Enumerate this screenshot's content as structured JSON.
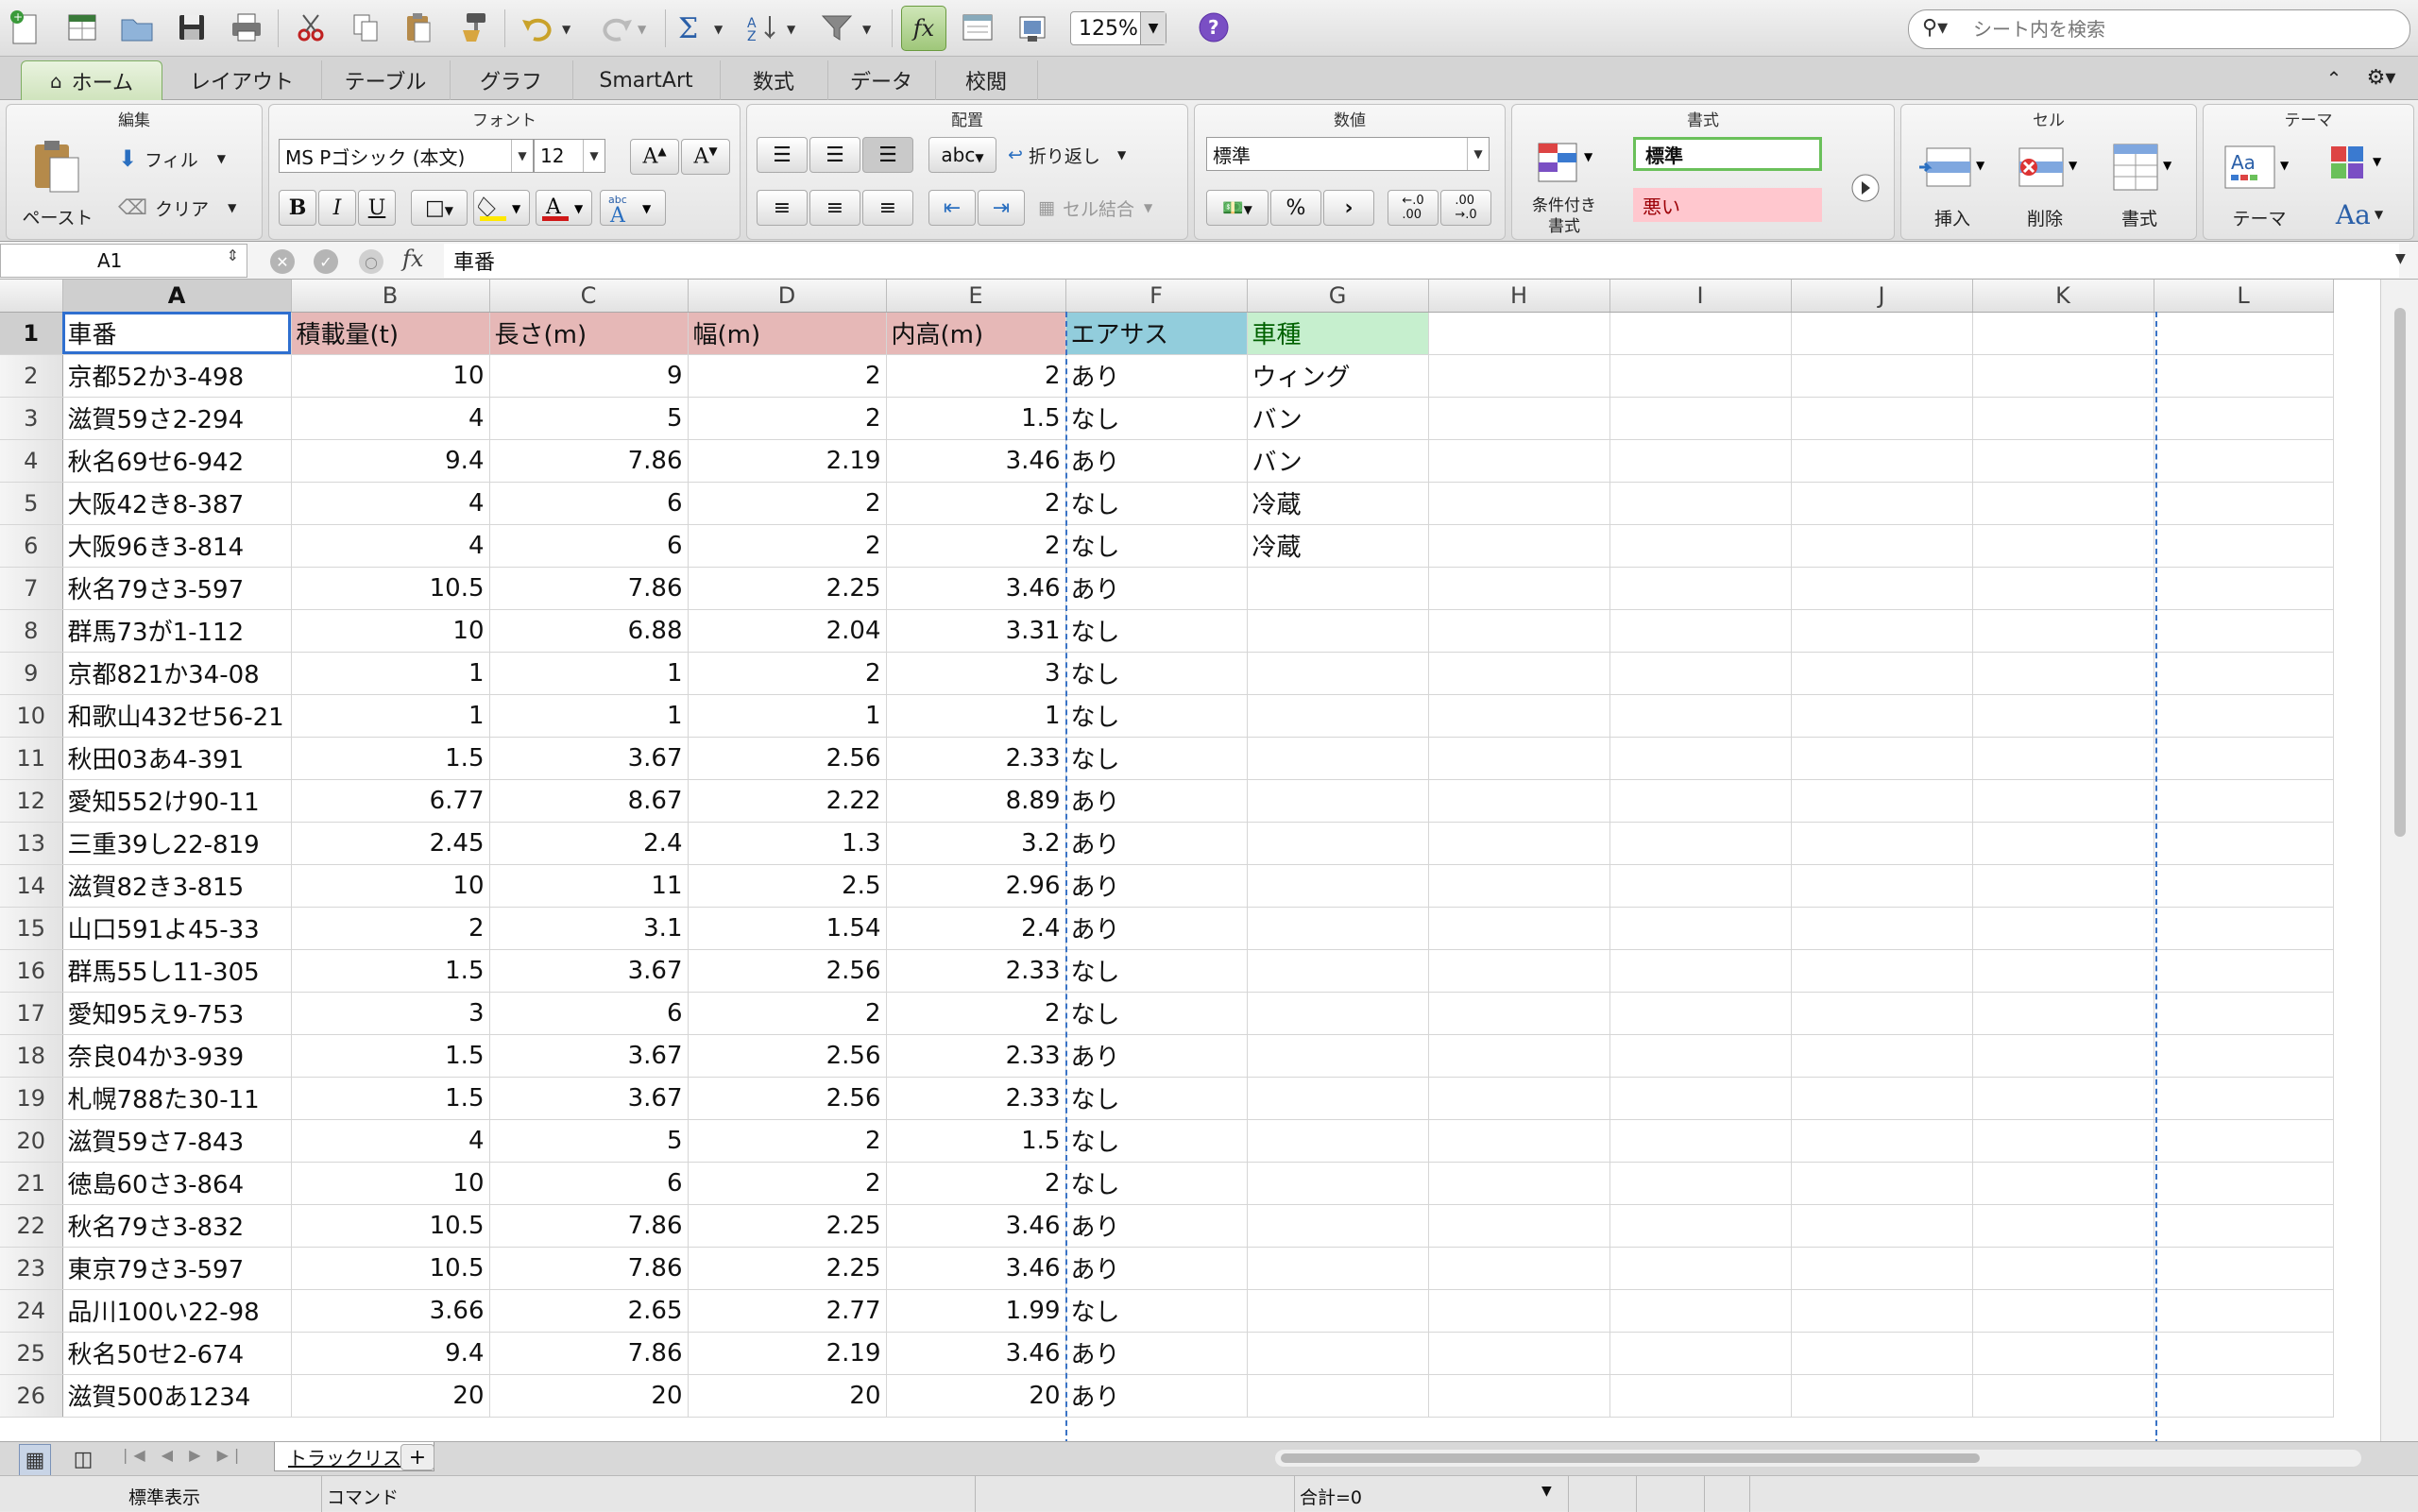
{
  "toolbar": {
    "zoom": "125%",
    "search_placeholder": "シート内を検索"
  },
  "tabs": [
    "ホーム",
    "レイアウト",
    "テーブル",
    "グラフ",
    "SmartArt",
    "数式",
    "データ",
    "校閲"
  ],
  "ribbon": {
    "edit": {
      "title": "編集",
      "paste": "ペースト",
      "fill": "フィル",
      "clear": "クリア"
    },
    "font": {
      "title": "フォント",
      "font_name": "MS Pゴシック (本文)",
      "font_size": "12"
    },
    "align": {
      "title": "配置",
      "wrap": "折り返し",
      "merge": "セル結合"
    },
    "number": {
      "title": "数値",
      "format": "標準"
    },
    "styles": {
      "title": "書式",
      "conditional": "条件付き\n書式",
      "normal": "標準",
      "bad": "悪い"
    },
    "cells": {
      "title": "セル",
      "insert": "挿入",
      "delete": "削除",
      "format": "書式"
    },
    "theme": {
      "title": "テーマ",
      "theme": "テーマ"
    }
  },
  "formula_bar": {
    "name_box": "A1",
    "fx": "fx",
    "value": "車番"
  },
  "columns": [
    "A",
    "B",
    "C",
    "D",
    "E",
    "F",
    "G",
    "H",
    "I",
    "J",
    "K",
    "L"
  ],
  "headers": [
    "車番",
    "積載量(t)",
    "長さ(m)",
    "幅(m)",
    "内高(m)",
    "エアサス",
    "車種"
  ],
  "rows": [
    [
      "京都52か3-498",
      "10",
      "9",
      "2",
      "2",
      "あり",
      "ウィング"
    ],
    [
      "滋賀59さ2-294",
      "4",
      "5",
      "2",
      "1.5",
      "なし",
      "バン"
    ],
    [
      "秋名69せ6-942",
      "9.4",
      "7.86",
      "2.19",
      "3.46",
      "あり",
      "バン"
    ],
    [
      "大阪42き8-387",
      "4",
      "6",
      "2",
      "2",
      "なし",
      "冷蔵"
    ],
    [
      "大阪96き3-814",
      "4",
      "6",
      "2",
      "2",
      "なし",
      "冷蔵"
    ],
    [
      "秋名79さ3-597",
      "10.5",
      "7.86",
      "2.25",
      "3.46",
      "あり",
      ""
    ],
    [
      "群馬73が1-112",
      "10",
      "6.88",
      "2.04",
      "3.31",
      "なし",
      ""
    ],
    [
      "京都821か34-08",
      "1",
      "1",
      "2",
      "3",
      "なし",
      ""
    ],
    [
      "和歌山432せ56-21",
      "1",
      "1",
      "1",
      "1",
      "なし",
      ""
    ],
    [
      "秋田03あ4-391",
      "1.5",
      "3.67",
      "2.56",
      "2.33",
      "なし",
      ""
    ],
    [
      "愛知552け90-11",
      "6.77",
      "8.67",
      "2.22",
      "8.89",
      "あり",
      ""
    ],
    [
      "三重39し22-819",
      "2.45",
      "2.4",
      "1.3",
      "3.2",
      "あり",
      ""
    ],
    [
      "滋賀82き3-815",
      "10",
      "11",
      "2.5",
      "2.96",
      "あり",
      ""
    ],
    [
      "山口591よ45-33",
      "2",
      "3.1",
      "1.54",
      "2.4",
      "あり",
      ""
    ],
    [
      "群馬55し11-305",
      "1.5",
      "3.67",
      "2.56",
      "2.33",
      "なし",
      ""
    ],
    [
      "愛知95え9-753",
      "3",
      "6",
      "2",
      "2",
      "なし",
      ""
    ],
    [
      "奈良04か3-939",
      "1.5",
      "3.67",
      "2.56",
      "2.33",
      "あり",
      ""
    ],
    [
      "札幌788た30-11",
      "1.5",
      "3.67",
      "2.56",
      "2.33",
      "なし",
      ""
    ],
    [
      "滋賀59さ7-843",
      "4",
      "5",
      "2",
      "1.5",
      "なし",
      ""
    ],
    [
      "徳島60さ3-864",
      "10",
      "6",
      "2",
      "2",
      "なし",
      ""
    ],
    [
      "秋名79さ3-832",
      "10.5",
      "7.86",
      "2.25",
      "3.46",
      "あり",
      ""
    ],
    [
      "東京79さ3-597",
      "10.5",
      "7.86",
      "2.25",
      "3.46",
      "あり",
      ""
    ],
    [
      "品川100い22-98",
      "3.66",
      "2.65",
      "2.77",
      "1.99",
      "なし",
      ""
    ],
    [
      "秋名50せ2-674",
      "9.4",
      "7.86",
      "2.19",
      "3.46",
      "あり",
      ""
    ],
    [
      "滋賀500あ1234",
      "20",
      "20",
      "20",
      "20",
      "あり",
      ""
    ]
  ],
  "sheet": {
    "tab": "トラックリスト",
    "add": "+"
  },
  "status": {
    "view": "標準表示",
    "mode": "コマンド",
    "sum": "合計=0"
  },
  "colors": {
    "header_red": "#e6b8b7",
    "header_blue": "#92cddc",
    "header_green": "#c6efce",
    "selection": "#2f6fcf"
  }
}
